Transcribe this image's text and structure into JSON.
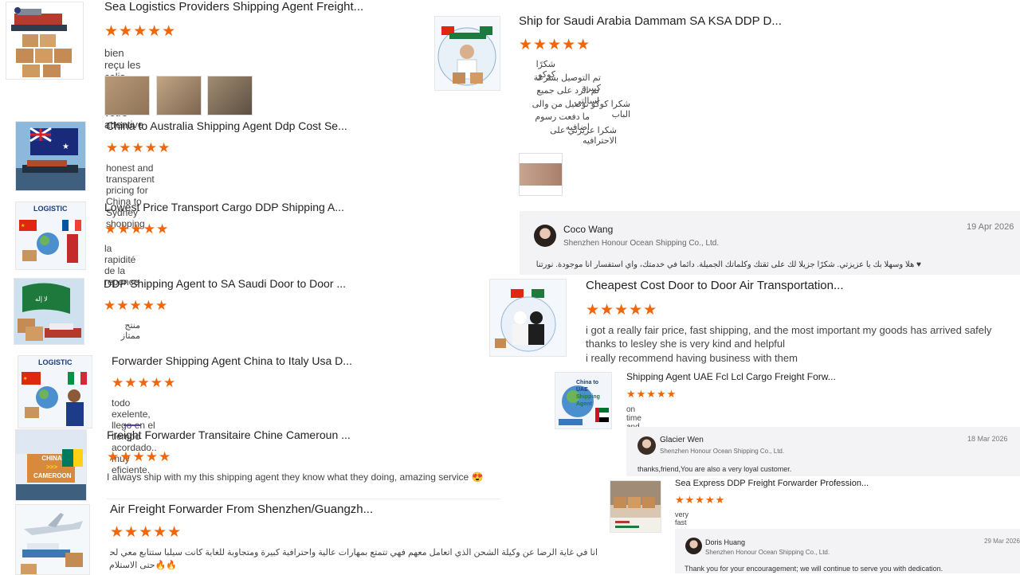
{
  "stars": "★★★★★",
  "reviews": [
    {
      "title": "Sea Logistics Providers Shipping Agent Freight...",
      "text": "bien reçu les colis bravo pour votre attentive",
      "thumb": "ship-cargo-boxes"
    },
    {
      "title": "China to Australia Shipping Agent Ddp Cost Se...",
      "text": "honest and transparent pricing for China to Sydney shopping",
      "thumb": "australia-flag-ship"
    },
    {
      "title": "Lowest Price Transport Cargo DDP Shipping A...",
      "text": "la rapidité de la reponce",
      "thumb": "china-france-logistics",
      "badge": "LOGISTIC"
    },
    {
      "title": "DDP Shipping Agent to SA Saudi Door to Door ...",
      "text": "منتج ممتاز",
      "thumb": "saudi-flag-ship"
    },
    {
      "title": "Forwarder Shipping Agent China to Italy Usa D...",
      "text": "todo exelente, llego en el tiempo acordado.. muy eficiente.",
      "thumb": "china-italy-logistics",
      "badge": "LOGISTIC"
    },
    {
      "title": "Freight Forwarder Transitaire Chine Cameroun ...",
      "text": "I always ship with my this shipping agent they know what they doing, amazing service 😍",
      "thumb": "china-cameroon-logistics",
      "badge_lines": [
        "CHINA",
        ">>>",
        "CAMEROON"
      ]
    },
    {
      "title": "Air Freight Forwarder From Shenzhen/Guangzh...",
      "text_lines": [
        "انا في غاية الرضا عن وكيلة الشحن الذي اتعامل معهم فهي تتمتع بمهارات عالية واحترافية كبيرة ومتجاوبة للغاية كانت سيلبا ستتابع معي لحظة بلحظة",
        "🔥🔥حتى الاستلام"
      ],
      "thumb": "air-freight-plane"
    },
    {
      "title": "Ship for Saudi Arabia Dammam SA KSA DDP D...",
      "text_lines": [
        "شكرًا كوكو",
        "تم التوصيل بسرعة كبيرة",
        "تم الرد على جميع اسالتي",
        "شكرا كوكو توصيل من والى الباب",
        "ما دفعت رسوم اضافيه",
        "شكرا عزيزتي على الاحترافيه"
      ],
      "thumb": "saudi-shipping-man"
    },
    {
      "title": "Cheapest Cost Door to Door Air Transportation...",
      "text_lines": [
        "i got a really fair price, fast shipping, and the most important my goods has arrived safely",
        "thanks to lesley she is very kind and helpful",
        "i really recommend having business with them"
      ],
      "thumb": "china-saudi-couple"
    },
    {
      "title": "Shipping Agent UAE Fcl Lcl Cargo Freight Forw...",
      "text": "on time and reliable",
      "thumb": "china-to-uae",
      "badge_lines": [
        "China to UAE",
        "Shipping",
        "Agent"
      ]
    },
    {
      "title": "Sea Express DDP Freight Forwarder Profession...",
      "text": "very fast",
      "thumb": "warehouse-boxes"
    }
  ],
  "replies": [
    {
      "name": "Coco Wang",
      "company": "Shenzhen Honour Ocean Shipping Co., Ltd.",
      "date": "19 Apr 2026",
      "text": "♥ هلا وسهلا بك يا عزيزتي. شكرًا جزيلًا لك على ثقتك وكلماتك الجميلة. دائماً في خدمتك، وأي استفسار أنا موجودة. نورتنا"
    },
    {
      "name": "Glacier Wen",
      "company": "Shenzhen Honour Ocean Shipping Co., Ltd.",
      "date": "18 Mar 2026",
      "text": "thanks,friend,You are also a very loyal customer."
    },
    {
      "name": "Doris Huang",
      "company": "Shenzhen Honour Ocean Shipping Co., Ltd.",
      "date": "29 Mar 2026",
      "text": "Thank you for your encouragement; we will continue to serve you with dedication."
    }
  ],
  "colors": {
    "star": "#f0660a",
    "reply_bg": "#f3f3f5",
    "accent": "#5a3ea6"
  }
}
